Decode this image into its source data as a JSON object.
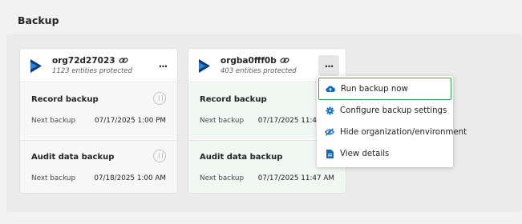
{
  "page": {
    "title": "Backup"
  },
  "cards": [
    {
      "org_name": "org72d27023",
      "entities": "1123 entities protected",
      "more_label": "...",
      "record": {
        "title": "Record backup",
        "next_label": "Next backup",
        "next_value": "07/17/2025 1:00 PM"
      },
      "audit": {
        "title": "Audit data backup",
        "next_label": "Next backup",
        "next_value": "07/18/2025 1:00 AM"
      }
    },
    {
      "org_name": "orgba0fff0b",
      "entities": "403 entities protected",
      "more_label": "...",
      "record": {
        "title": "Record backup",
        "next_label": "Next backup",
        "next_value": "07/17/2025 11:47 AM"
      },
      "audit": {
        "title": "Audit data backup",
        "next_label": "Next backup",
        "next_value": "07/17/2025 11:47 AM"
      }
    }
  ],
  "menu": {
    "items": [
      {
        "label": "Run backup now",
        "icon": "cloud-upload-icon"
      },
      {
        "label": "Configure backup settings",
        "icon": "gear-icon"
      },
      {
        "label": "Hide organization/environment",
        "icon": "eye-off-icon"
      },
      {
        "label": "View details",
        "icon": "document-icon"
      }
    ]
  },
  "colors": {
    "accent": "#0f6cbd",
    "highlight_border": "#2fa84f",
    "logo_dark": "#0b3a7a",
    "logo_light": "#2d7fd3"
  }
}
